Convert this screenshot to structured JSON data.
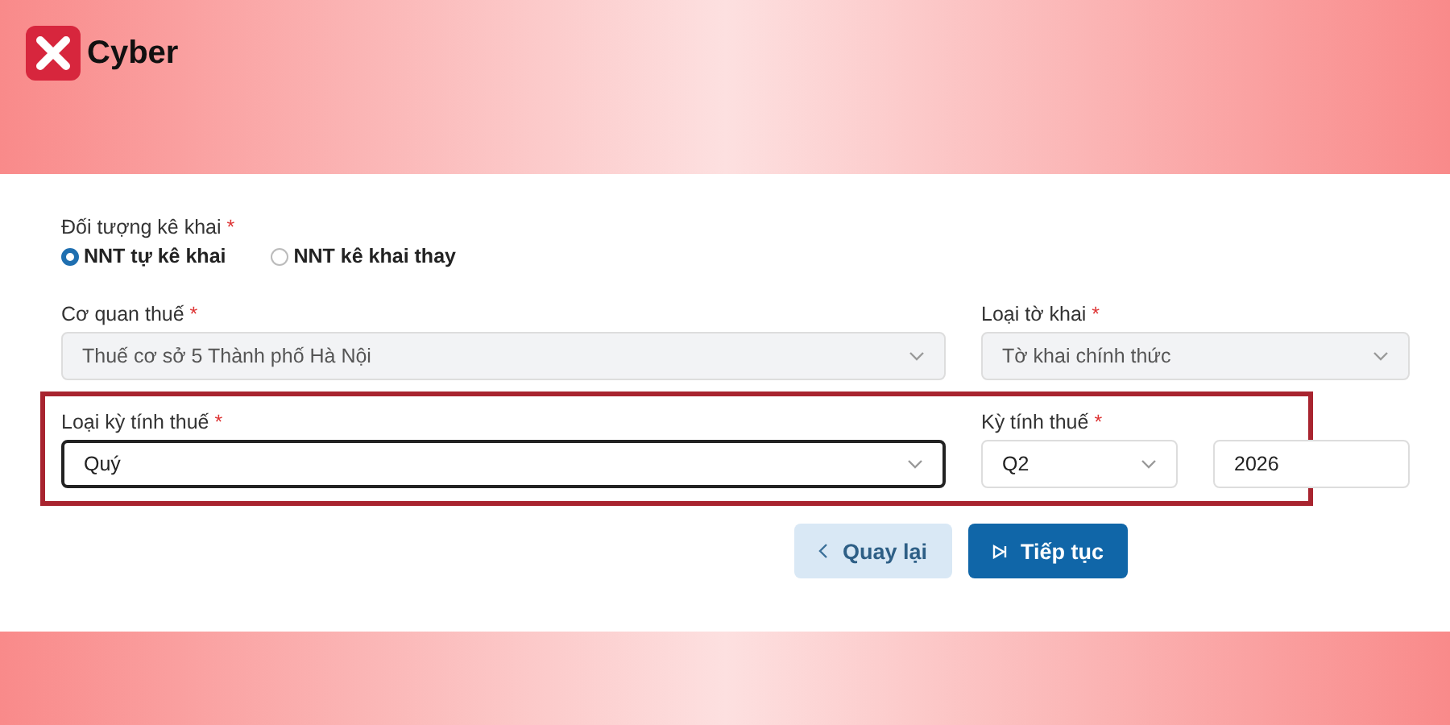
{
  "brand": {
    "name": "Cyber"
  },
  "declarant": {
    "label": "Đối tượng kê khai",
    "required_mark": "*",
    "options": [
      {
        "label": "NNT tự kê khai",
        "selected": true
      },
      {
        "label": "NNT kê khai thay",
        "selected": false
      }
    ]
  },
  "fields": [
    {
      "kind": "select",
      "label": "Cơ quan thuế",
      "required_mark": "*",
      "value": "Thuế cơ sở 5 Thành phố Hà Nội",
      "disabled": true,
      "focused": false
    },
    {
      "kind": "select",
      "label": "Loại tờ khai",
      "required_mark": "*",
      "value": "Tờ khai chính thức",
      "disabled": true,
      "focused": false
    },
    {
      "kind": "select",
      "label": "Loại kỳ tính thuế",
      "required_mark": "*",
      "value": "Quý",
      "disabled": false,
      "focused": true
    },
    {
      "kind": "period",
      "label": "Kỳ tính thuế",
      "required_mark": "*",
      "value": "Q2",
      "year": "2026",
      "disabled": false
    }
  ],
  "highlight": {
    "on": true
  },
  "buttons": [
    {
      "kind": "back",
      "label": "Quay lại"
    },
    {
      "kind": "next",
      "label": "Tiếp tục"
    }
  ]
}
